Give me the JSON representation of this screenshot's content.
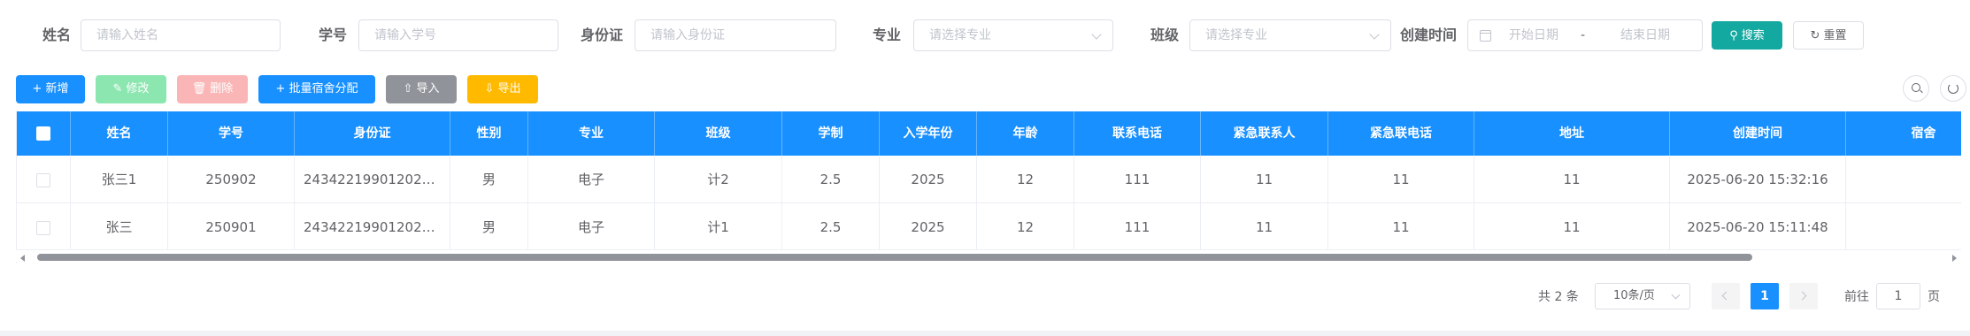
{
  "search_form": {
    "fields": [
      {
        "label": "姓名",
        "placeholder": "请输入姓名"
      },
      {
        "label": "学号",
        "placeholder": "请输入学号"
      },
      {
        "label": "身份证",
        "placeholder": "请输入身份证"
      },
      {
        "label": "专业",
        "placeholder": "请选择专业"
      },
      {
        "label": "班级",
        "placeholder": "请选择专业"
      },
      {
        "label": "创建时间",
        "start_placeholder": "开始日期",
        "separator": "-",
        "end_placeholder": "结束日期"
      }
    ],
    "search_label": "搜索",
    "reset_label": "重置"
  },
  "toolbar": {
    "add_label": "新增",
    "edit_label": "修改",
    "delete_label": "删除",
    "assign_label": "批量宿舍分配",
    "import_label": "导入",
    "export_label": "导出"
  },
  "table": {
    "columns": [
      "姓名",
      "学号",
      "身份证",
      "性别",
      "专业",
      "班级",
      "学制",
      "入学年份",
      "年龄",
      "联系电话",
      "紧急联系人",
      "紧急联电话",
      "地址",
      "创建时间",
      "宿舍"
    ],
    "rows": [
      [
        "张三1",
        "250902",
        "243422199012027...",
        "男",
        "电子",
        "计2",
        "2.5",
        "2025",
        "12",
        "111",
        "11",
        "11",
        "11",
        "2025-06-20 15:32:16",
        ""
      ],
      [
        "张三",
        "250901",
        "243422199012027...",
        "男",
        "电子",
        "计1",
        "2.5",
        "2025",
        "12",
        "111",
        "11",
        "11",
        "11",
        "2025-06-20 15:11:48",
        ""
      ]
    ]
  },
  "pagination": {
    "total_text": "共 2 条",
    "page_size": "10条/页",
    "current_page": "1",
    "goto_label": "前往",
    "goto_value": "1",
    "page_unit": "页"
  },
  "colors": {
    "primary": "#1890ff",
    "search": "#13a8a0",
    "edit_disabled": "#8ce6b0",
    "delete_disabled": "#fab6b6",
    "import": "#909399",
    "export": "#ffba00"
  }
}
